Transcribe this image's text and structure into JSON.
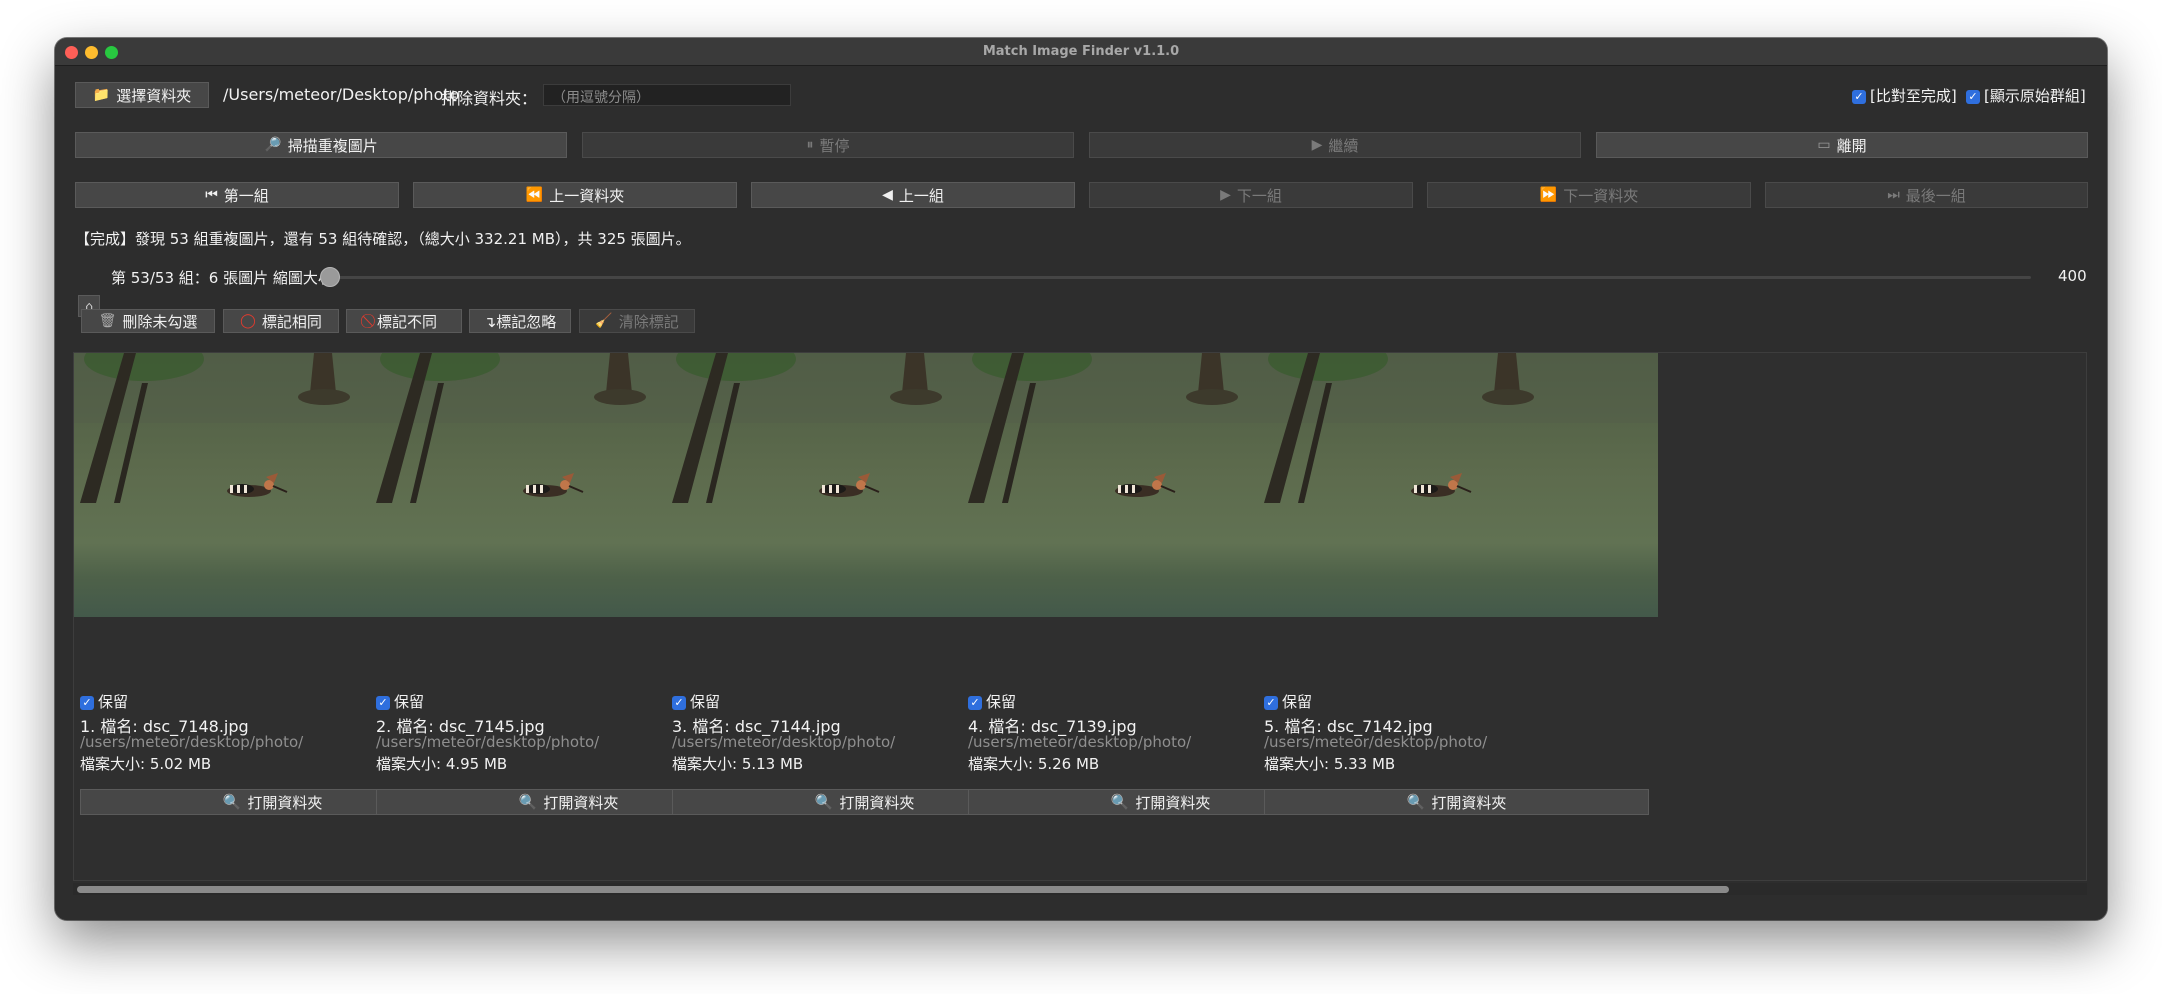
{
  "window": {
    "title": "Match Image Finder v1.1.0"
  },
  "toolbar": {
    "choose_folder_label": "選擇資料夾",
    "folder_path": "/Users/meteor/Desktop/photo",
    "exclude_label": "排除資料夾：",
    "exclude_placeholder": "（用逗號分隔）",
    "compare_to_end_label": "[比對至完成]",
    "show_original_group_label": "[顯示原始群組]",
    "compare_to_end_checked": true,
    "show_original_group_checked": true
  },
  "actions": {
    "scan_label": "掃描重複圖片",
    "pause_label": "暫停",
    "continue_label": "繼續",
    "exit_label": "離開"
  },
  "nav": {
    "first_group": "第一組",
    "prev_folder": "上一資料夾",
    "prev_group": "上一組",
    "next_group": "下一組",
    "next_folder": "下一資料夾",
    "last_group": "最後一組"
  },
  "status_text": "【完成】發現 53 組重複圖片，還有 53 組待確認，（總大小 332.21 MB），共 325 張圖片。",
  "group_info": {
    "text": "第 53/53 組：6 張圖片  縮圖大小",
    "thumb_size_value": "400",
    "thumb_size_min": 0,
    "thumb_size_max": 400,
    "thumb_size_level": 0
  },
  "marks": {
    "delete_unchecked": "刪除未勾選",
    "mark_same": "標記相同",
    "mark_different": "標記不同",
    "mark_ignore": "↴標記忽略",
    "clear_marks": "清除標記"
  },
  "cards": [
    {
      "keep_label": "保留",
      "name": "1. 檔名: dsc_7148.jpg",
      "path": "/users/meteor/desktop/photo/",
      "size": "檔案大小: 5.02 MB",
      "open_label": "打開資料夾",
      "keep": true
    },
    {
      "keep_label": "保留",
      "name": "2. 檔名: dsc_7145.jpg",
      "path": "/users/meteor/desktop/photo/",
      "size": "檔案大小: 4.95 MB",
      "open_label": "打開資料夾",
      "keep": true
    },
    {
      "keep_label": "保留",
      "name": "3. 檔名: dsc_7144.jpg",
      "path": "/users/meteor/desktop/photo/",
      "size": "檔案大小: 5.13 MB",
      "open_label": "打開資料夾",
      "keep": true
    },
    {
      "keep_label": "保留",
      "name": "4. 檔名: dsc_7139.jpg",
      "path": "/users/meteor/desktop/photo/",
      "size": "檔案大小: 5.26 MB",
      "open_label": "打開資料夾",
      "keep": true
    },
    {
      "keep_label": "保留",
      "name": "5. 檔名: dsc_7142.jpg",
      "path": "/users/meteor/desktop/photo/",
      "size": "檔案大小: 5.33 MB",
      "open_label": "打開資料夾",
      "keep": true
    }
  ],
  "icons": {
    "folder": "folder-icon",
    "search": "magnifier-icon",
    "pause": "pause-icon",
    "play": "play-icon",
    "door": "door-icon",
    "first": "skip-first-icon",
    "rewind": "rewind-icon",
    "prev": "triangle-left-icon",
    "next": "triangle-right-icon",
    "fastforward": "fast-forward-icon",
    "last": "skip-last-icon",
    "trash": "trash-icon",
    "circle": "red-circle-icon",
    "prohibited": "prohibited-icon",
    "broom": "broom-icon",
    "home": "home-icon"
  },
  "colors": {
    "window_bg": "#2d2d2d",
    "button_bg": "#474747",
    "checkbox": "#2f6fde",
    "mark_red": "#e03b2f"
  }
}
